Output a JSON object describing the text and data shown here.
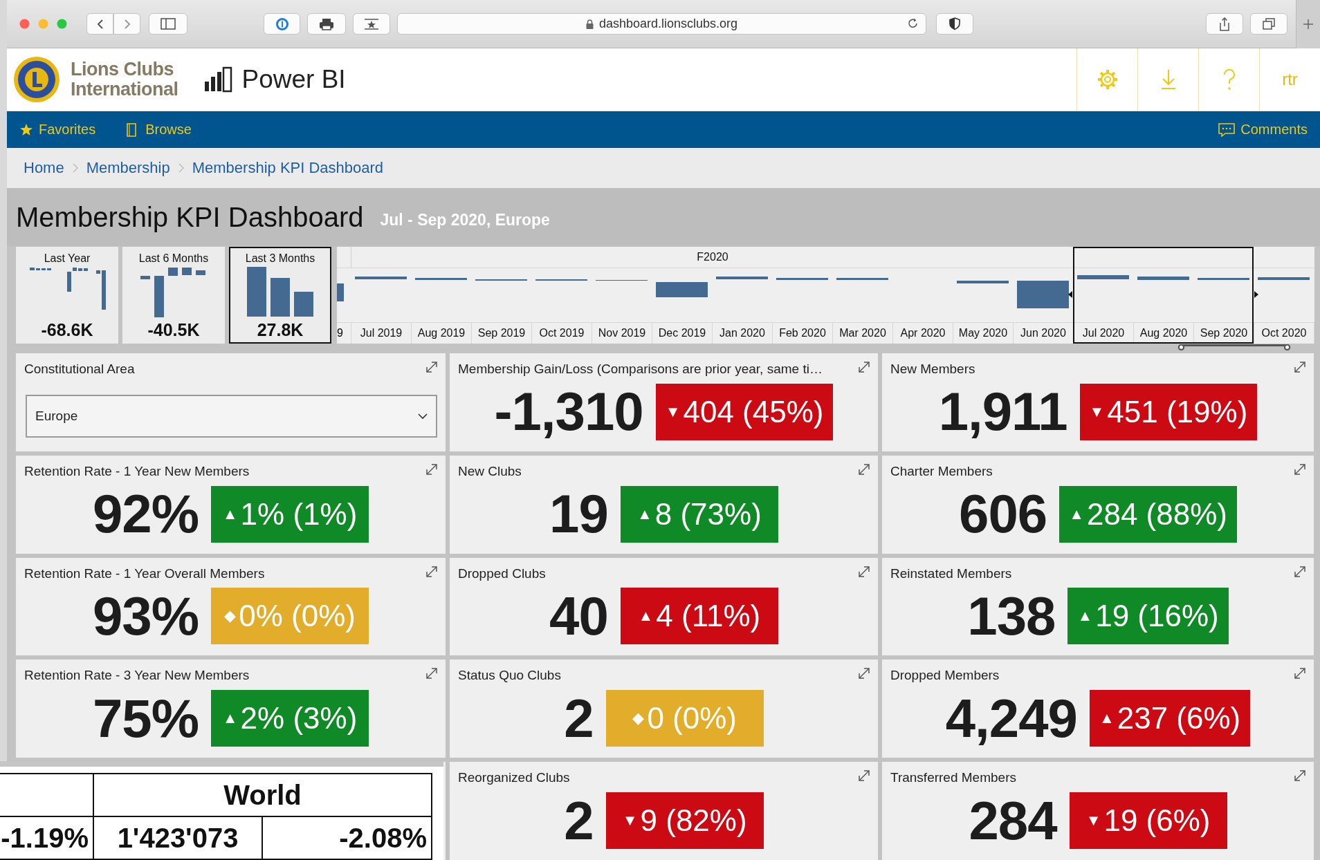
{
  "browser": {
    "url": "dashboard.lionsclubs.org"
  },
  "header": {
    "brand_lines": [
      "Lions Clubs",
      "International"
    ],
    "app_name": "Power BI",
    "user": "rtr"
  },
  "nav": {
    "left": [
      {
        "kind": "star",
        "label": "Favorites"
      },
      {
        "kind": "page",
        "label": "Browse"
      }
    ],
    "right": [
      {
        "kind": "comment",
        "label": "Comments"
      }
    ]
  },
  "breadcrumb": [
    "Home",
    "Membership",
    "Membership KPI Dashboard"
  ],
  "title": "Membership KPI Dashboard",
  "subtitle": "Jul - Sep 2020, Europe",
  "period_slicers": [
    {
      "label": "Last Year",
      "value": "-68.6K",
      "selected": false
    },
    {
      "label": "Last 6 Months",
      "value": "-40.5K",
      "selected": false
    },
    {
      "label": "Last 3 Months",
      "value": "27.8K",
      "selected": true
    }
  ],
  "timeline": {
    "partial_label": "9",
    "fiscal_label": "F2020",
    "months": [
      {
        "label": "Jul 2019",
        "selected": false
      },
      {
        "label": "Aug 2019",
        "selected": false
      },
      {
        "label": "Sep 2019",
        "selected": false
      },
      {
        "label": "Oct 2019",
        "selected": false
      },
      {
        "label": "Nov 2019",
        "selected": false
      },
      {
        "label": "Dec 2019",
        "selected": false
      },
      {
        "label": "Jan 2020",
        "selected": false
      },
      {
        "label": "Feb 2020",
        "selected": false
      },
      {
        "label": "Mar 2020",
        "selected": false
      },
      {
        "label": "Apr 2020",
        "selected": false
      },
      {
        "label": "May 2020",
        "selected": false
      },
      {
        "label": "Jun 2020",
        "selected": false
      },
      {
        "label": "Jul 2020",
        "selected": true
      },
      {
        "label": "Aug 2020",
        "selected": true
      },
      {
        "label": "Sep 2020",
        "selected": true
      },
      {
        "label": "Oct 2020",
        "selected": false
      }
    ]
  },
  "tiles": [
    {
      "kind": "dropdown",
      "title": "Constitutional Area",
      "value": "Europe"
    },
    {
      "kind": "kpi",
      "title": "Membership Gain/Loss (Comparisons are prior year, same ti…",
      "value": "-1,310",
      "arrow": "▼",
      "delta": "404 (45%)",
      "color": "#cc0a14"
    },
    {
      "kind": "kpi",
      "title": "New Members",
      "value": "1,911",
      "arrow": "▼",
      "delta": "451 (19%)",
      "color": "#cc0a14"
    },
    {
      "kind": "kpi",
      "title": "Retention Rate - 1 Year New Members",
      "value": "92%",
      "arrow": "▲",
      "delta": "1% (1%)",
      "color": "#0f8a26"
    },
    {
      "kind": "kpi",
      "title": "New Clubs",
      "value": "19",
      "arrow": "▲",
      "delta": "8 (73%)",
      "color": "#0f8a26"
    },
    {
      "kind": "kpi",
      "title": "Charter Members",
      "value": "606",
      "arrow": "▲",
      "delta": "284 (88%)",
      "color": "#0f8a26"
    },
    {
      "kind": "kpi",
      "title": "Retention Rate - 1 Year Overall Members",
      "value": "93%",
      "arrow": "◆",
      "delta": "0% (0%)",
      "color": "#e2ad2b"
    },
    {
      "kind": "kpi",
      "title": "Dropped Clubs",
      "value": "40",
      "arrow": "▲",
      "delta": "4 (11%)",
      "color": "#cc0a14"
    },
    {
      "kind": "kpi",
      "title": "Reinstated Members",
      "value": "138",
      "arrow": "▲",
      "delta": "19 (16%)",
      "color": "#0f8a26"
    },
    {
      "kind": "kpi",
      "title": "Retention Rate - 3 Year New Members",
      "value": "75%",
      "arrow": "▲",
      "delta": "2% (3%)",
      "color": "#0f8a26"
    },
    {
      "kind": "kpi",
      "title": "Status Quo Clubs",
      "value": "2",
      "arrow": "◆",
      "delta": "0 (0%)",
      "color": "#e2ad2b"
    },
    {
      "kind": "kpi",
      "title": "Dropped Members",
      "value": "4,249",
      "arrow": "▲",
      "delta": "237 (6%)",
      "color": "#cc0a14"
    },
    {
      "kind": "hidden"
    },
    {
      "kind": "kpi",
      "title": "Reorganized Clubs",
      "value": "2",
      "arrow": "▼",
      "delta": "9 (82%)",
      "color": "#cc0a14"
    },
    {
      "kind": "kpi",
      "title": "Transferred Members",
      "value": "284",
      "arrow": "▼",
      "delta": "19 (6%)",
      "color": "#cc0a14"
    }
  ],
  "overlay_table": {
    "header": "World",
    "row": [
      "-1.19%",
      "1'423'073",
      "-2.08%"
    ]
  }
}
